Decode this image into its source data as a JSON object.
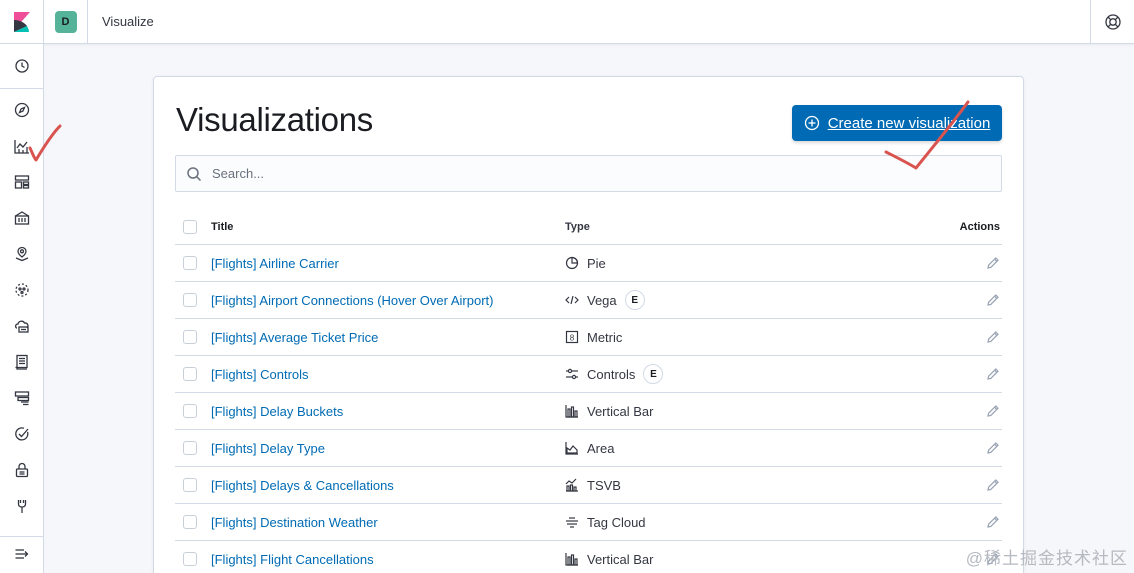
{
  "header": {
    "logo": "kibana-logo",
    "space_initial": "D",
    "app_title": "Visualize",
    "help_icon": "help-lifebuoy-icon"
  },
  "sidebar": {
    "items": [
      {
        "icon": "clock-icon"
      },
      {
        "icon": "compass-icon"
      },
      {
        "icon": "visualize-icon"
      },
      {
        "icon": "dashboard-icon"
      },
      {
        "icon": "canvas-icon"
      },
      {
        "icon": "maps-icon"
      },
      {
        "icon": "ml-icon"
      },
      {
        "icon": "infrastructure-icon"
      },
      {
        "icon": "logs-icon"
      },
      {
        "icon": "apm-icon"
      },
      {
        "icon": "uptime-icon"
      },
      {
        "icon": "siem-icon"
      },
      {
        "icon": "dev-tools-icon"
      },
      {
        "icon": "collapse-menu-icon"
      }
    ]
  },
  "main": {
    "title": "Visualizations",
    "create_button": "Create new visualization",
    "search_placeholder": "Search...",
    "columns": {
      "title": "Title",
      "type": "Type",
      "actions": "Actions"
    },
    "rows": [
      {
        "title": "[Flights] Airline Carrier",
        "type": "Pie",
        "icon": "pie-icon",
        "badge": ""
      },
      {
        "title": "[Flights] Airport Connections (Hover Over Airport)",
        "type": "Vega",
        "icon": "code-icon",
        "badge": "E"
      },
      {
        "title": "[Flights] Average Ticket Price",
        "type": "Metric",
        "icon": "metric-icon",
        "badge": ""
      },
      {
        "title": "[Flights] Controls",
        "type": "Controls",
        "icon": "controls-icon",
        "badge": "E"
      },
      {
        "title": "[Flights] Delay Buckets",
        "type": "Vertical Bar",
        "icon": "vertical-bar-icon",
        "badge": ""
      },
      {
        "title": "[Flights] Delay Type",
        "type": "Area",
        "icon": "area-icon",
        "badge": ""
      },
      {
        "title": "[Flights] Delays & Cancellations",
        "type": "TSVB",
        "icon": "tsvb-icon",
        "badge": ""
      },
      {
        "title": "[Flights] Destination Weather",
        "type": "Tag Cloud",
        "icon": "tag-cloud-icon",
        "badge": ""
      },
      {
        "title": "[Flights] Flight Cancellations",
        "type": "Vertical Bar",
        "icon": "vertical-bar-icon",
        "badge": ""
      }
    ]
  },
  "watermark": "@稀土掘金技术社区",
  "colors": {
    "primary": "#006bb4",
    "annotation": "#d9534f",
    "space_avatar": "#54b399"
  }
}
